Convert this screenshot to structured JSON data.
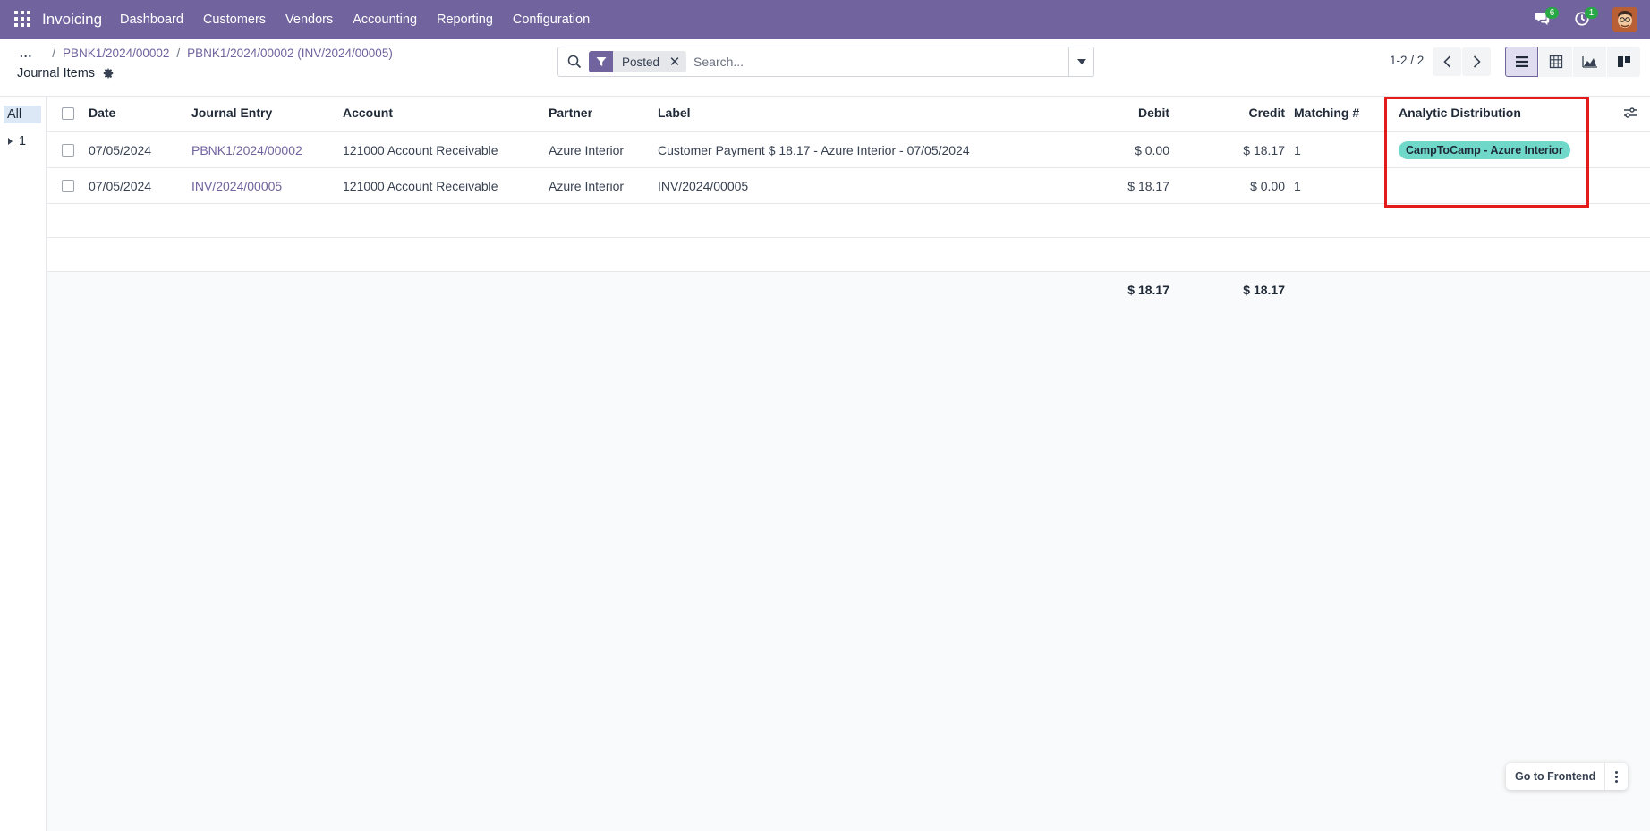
{
  "navbar": {
    "brand": "Invoicing",
    "menu": [
      "Dashboard",
      "Customers",
      "Vendors",
      "Accounting",
      "Reporting",
      "Configuration"
    ],
    "messages_count": "6",
    "activities_count": "1",
    "color": "#71639e"
  },
  "breadcrumb": {
    "dots": "...",
    "items": [
      "PBNK1/2024/00002",
      "PBNK1/2024/00002 (INV/2024/00005)"
    ]
  },
  "page_title": "Journal Items",
  "search": {
    "facet": "Posted",
    "placeholder": "Search..."
  },
  "pager": {
    "range": "1-2 / 2"
  },
  "side_panel": {
    "all_label": "All",
    "group": "1"
  },
  "table": {
    "headers": {
      "date": "Date",
      "journal_entry": "Journal Entry",
      "account": "Account",
      "partner": "Partner",
      "label": "Label",
      "debit": "Debit",
      "credit": "Credit",
      "matching": "Matching #",
      "analytic": "Analytic Distribution"
    },
    "rows": [
      {
        "date": "07/05/2024",
        "journal_entry": "PBNK1/2024/00002",
        "account": "121000 Account Receivable",
        "partner": "Azure Interior",
        "label": "Customer Payment $ 18.17 - Azure Interior - 07/05/2024",
        "debit": "$ 0.00",
        "credit": "$ 18.17",
        "matching": "1",
        "analytic": "CampToCamp - Azure Interior"
      },
      {
        "date": "07/05/2024",
        "journal_entry": "INV/2024/00005",
        "account": "121000 Account Receivable",
        "partner": "Azure Interior",
        "label": "INV/2024/00005",
        "debit": "$ 18.17",
        "credit": "$ 0.00",
        "matching": "1",
        "analytic": ""
      }
    ],
    "totals": {
      "debit": "$ 18.17",
      "credit": "$ 18.17"
    }
  },
  "frontend_button": {
    "label": "Go to Frontend"
  },
  "colors": {
    "accent": "#71639e",
    "tag": "#6fd8c8",
    "highlight": "#e31b1b"
  }
}
